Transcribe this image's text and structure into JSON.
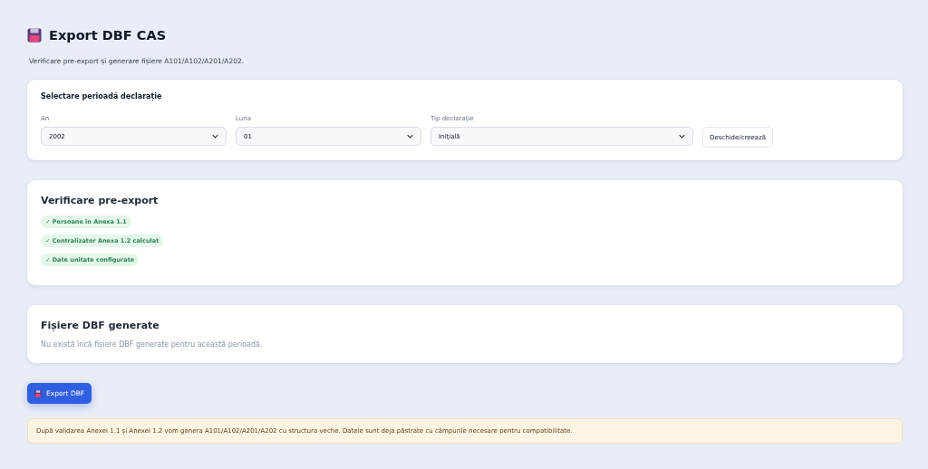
{
  "page": {
    "title": "Export DBF CAS",
    "subtitle": "Verificare pre-export și generare fișiere A101/A102/A201/A202."
  },
  "period": {
    "title": "Selectare perioadă declarație",
    "fields": [
      {
        "label": "An",
        "value": "2002"
      },
      {
        "label": "Luna",
        "value": "01"
      },
      {
        "label": "Tip declarație",
        "value": "Inițială"
      }
    ],
    "button": "Deschide/creează"
  },
  "checks": {
    "title": "Verificare pre-export",
    "items": [
      {
        "label": "✓ Persoane în Anexa 1.1",
        "passed": true
      },
      {
        "label": "✓ Centralizator Anexa 1.2 calculat",
        "passed": true
      },
      {
        "label": "✓ Date unitate configurate",
        "passed": true
      }
    ]
  },
  "files": {
    "title": "Fișiere DBF generate",
    "empty_text": "Nu există încă fișiere DBF generate pentru această perioadă."
  },
  "export_button": "Export DBF",
  "notice": "După validarea Anexei 1.1 și Anexei 1.2 vom genera A101/A102/A201/A202 cu structura veche. Datele sunt deja păstrate cu câmpurile necesare pentru compatibilitate."
}
